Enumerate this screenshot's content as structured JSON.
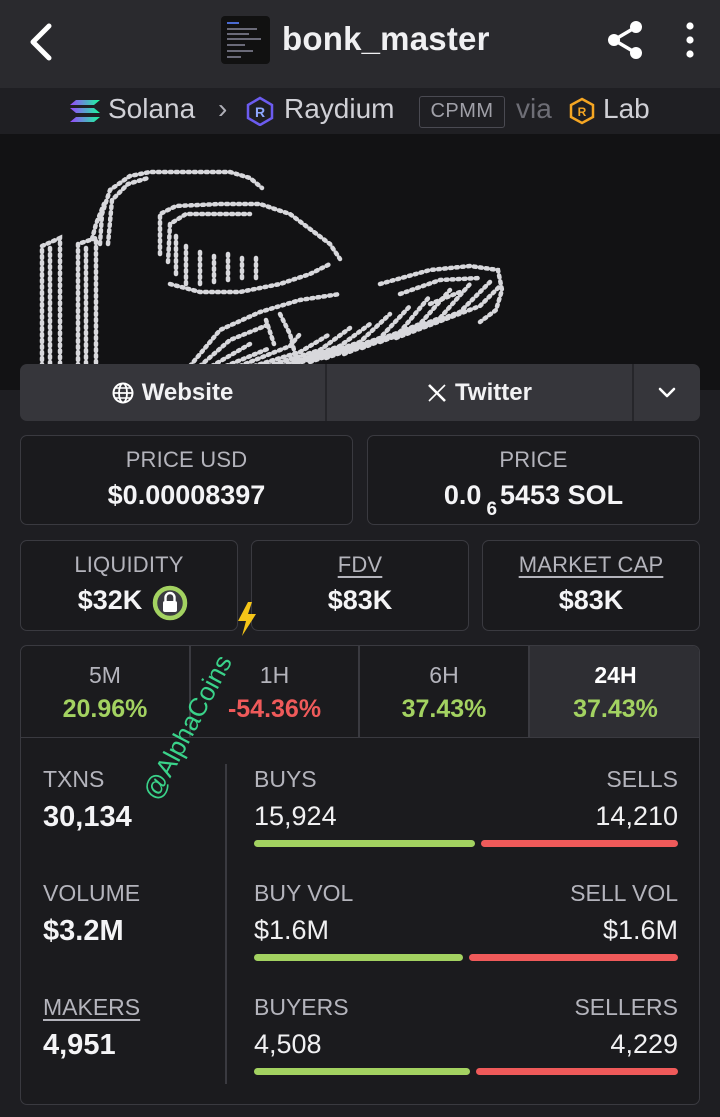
{
  "header": {
    "token_name": "bonk_master",
    "back_icon": "chevron-left-icon",
    "share_icon": "share-icon",
    "menu_icon": "more-vertical-icon"
  },
  "path": {
    "chain": "Solana",
    "dex": "Raydium",
    "pool_type": "CPMM",
    "via": "via",
    "launchpad": "Lab"
  },
  "links": {
    "website": "Website",
    "twitter": "Twitter"
  },
  "stats": {
    "price_usd_label": "PRICE USD",
    "price_usd": "$0.00008397",
    "price_label": "PRICE",
    "price_sol_prefix": "0.0",
    "price_sol_zeros": "6",
    "price_sol_rest": "5453 SOL",
    "liquidity_label": "LIQUIDITY",
    "liquidity": "$32K",
    "fdv_label": "FDV",
    "fdv": "$83K",
    "mcap_label": "MARKET CAP",
    "mcap": "$83K"
  },
  "timeframes": [
    {
      "label": "5M",
      "change": "20.96%"
    },
    {
      "label": "1H",
      "change": "-54.36%"
    },
    {
      "label": "6H",
      "change": "37.43%"
    },
    {
      "label": "24H",
      "change": "37.43%"
    }
  ],
  "metrics": {
    "txns_label": "TXNS",
    "txns": "30,134",
    "volume_label": "VOLUME",
    "volume": "$3.2M",
    "makers_label": "MAKERS",
    "makers": "4,951",
    "buys_label": "BUYS",
    "buys": "15,924",
    "sells_label": "SELLS",
    "sells": "14,210",
    "buy_vol_label": "BUY VOL",
    "buy_vol": "$1.6M",
    "sell_vol_label": "SELL VOL",
    "sell_vol": "$1.6M",
    "buyers_label": "BUYERS",
    "buyers": "4,508",
    "sellers_label": "SELLERS",
    "sellers": "4,229"
  },
  "ratios": {
    "buys_fraction": 0.528,
    "buy_vol_fraction": 0.5,
    "buyers_fraction": 0.516
  },
  "watermark": "@AlphaCoins",
  "colors": {
    "positive": "#a3d261",
    "negative": "#ef5a5a",
    "raydium": "#6c5cf0",
    "lab": "#f5a623",
    "lock_ring": "#a3d261"
  }
}
